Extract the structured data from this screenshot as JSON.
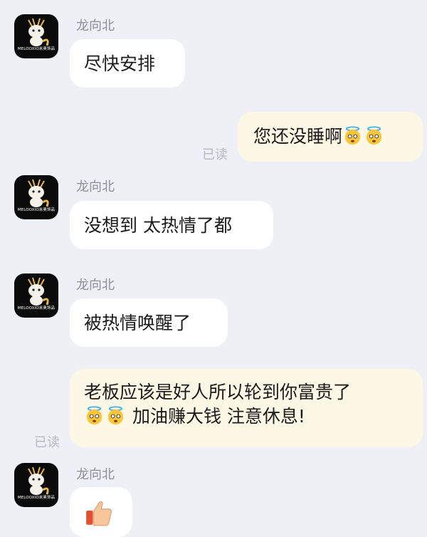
{
  "messages": [
    {
      "sender": "龙向北",
      "text": "尽快安排"
    },
    {
      "self_text": "您还没睡啊",
      "read_label": "已读"
    },
    {
      "sender": "龙向北",
      "text": "没想到 太热情了都"
    },
    {
      "sender": "龙向北",
      "text": "被热情唤醒了"
    },
    {
      "self_line1": "老板应该是好人所以轮到你富贵了",
      "self_line2": " 加油赚大钱 注意休息!",
      "read_label": "已读"
    },
    {
      "sender": "龙向北",
      "sticker": "thumbs-up-icon"
    }
  ],
  "avatar": {
    "brand_text": "MELOOXIO米奥饰品"
  },
  "emoji": {
    "name": "cold-sweat-halo-face-icon"
  },
  "colors": {
    "background": "#eef0f6",
    "incoming_bubble": "#ffffff",
    "outgoing_bubble": "#fdf7e6",
    "sender_text": "#8b8f99",
    "read_text": "#b5b9c2"
  }
}
